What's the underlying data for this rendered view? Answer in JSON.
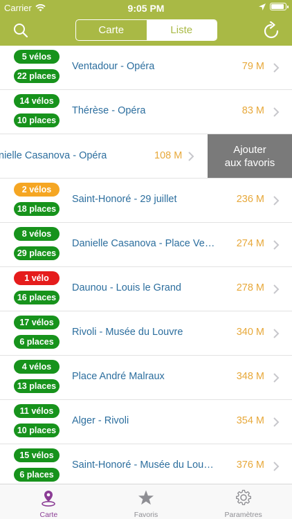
{
  "status": {
    "carrier": "Carrier",
    "time": "9:05 PM",
    "battery_level": 0.8
  },
  "nav": {
    "segments": [
      "Carte",
      "Liste"
    ],
    "selected": "Liste"
  },
  "stations": [
    {
      "bikes": "5 vélos",
      "bikes_color": "green",
      "places": "22 places",
      "name": "Ventadour - Opéra",
      "distance": "79 M"
    },
    {
      "bikes": "14 vélos",
      "bikes_color": "green",
      "places": "10 places",
      "name": "Thérèse - Opéra",
      "distance": "83 M"
    },
    {
      "name": "nielle Casanova - Opéra",
      "distance": "108 M",
      "action": "Ajouter aux favoris",
      "action_line1": "Ajouter",
      "action_line2": "aux favoris"
    },
    {
      "bikes": "2 vélos",
      "bikes_color": "orange",
      "places": "18 places",
      "name": "Saint-Honoré - 29 juillet",
      "distance": "236 M"
    },
    {
      "bikes": "8 vélos",
      "bikes_color": "green",
      "places": "29 places",
      "name": "Danielle Casanova - Place Ven...",
      "distance": "274 M"
    },
    {
      "bikes": "1 vélo",
      "bikes_color": "red",
      "places": "16 places",
      "name": "Daunou - Louis le Grand",
      "distance": "278 M"
    },
    {
      "bikes": "17 vélos",
      "bikes_color": "green",
      "places": "6 places",
      "name": "Rivoli - Musée du Louvre",
      "distance": "340 M"
    },
    {
      "bikes": "4 vélos",
      "bikes_color": "green",
      "places": "13 places",
      "name": "Place André Malraux",
      "distance": "348 M"
    },
    {
      "bikes": "11 vélos",
      "bikes_color": "green",
      "places": "10 places",
      "name": "Alger - Rivoli",
      "distance": "354 M"
    },
    {
      "bikes": "15 vélos",
      "bikes_color": "green",
      "places": "6 places",
      "name": "Saint-Honoré - Musée du Louvre",
      "distance": "376 M"
    }
  ],
  "tabs": [
    {
      "label": "Carte",
      "icon": "map-pin-icon",
      "active": true
    },
    {
      "label": "Favoris",
      "icon": "star-icon",
      "active": false
    },
    {
      "label": "Paramètres",
      "icon": "gear-icon",
      "active": false
    }
  ],
  "colors": {
    "brand": "#a9b945",
    "bikes_green": "#17931c",
    "bikes_orange": "#f5a623",
    "bikes_red": "#e51c1c",
    "station_name": "#2c6e9e",
    "distance": "#e7a83a",
    "tab_active": "#8b3d95",
    "tab_inactive": "#8e8e93",
    "swipe_action": "#7a7a7a"
  }
}
